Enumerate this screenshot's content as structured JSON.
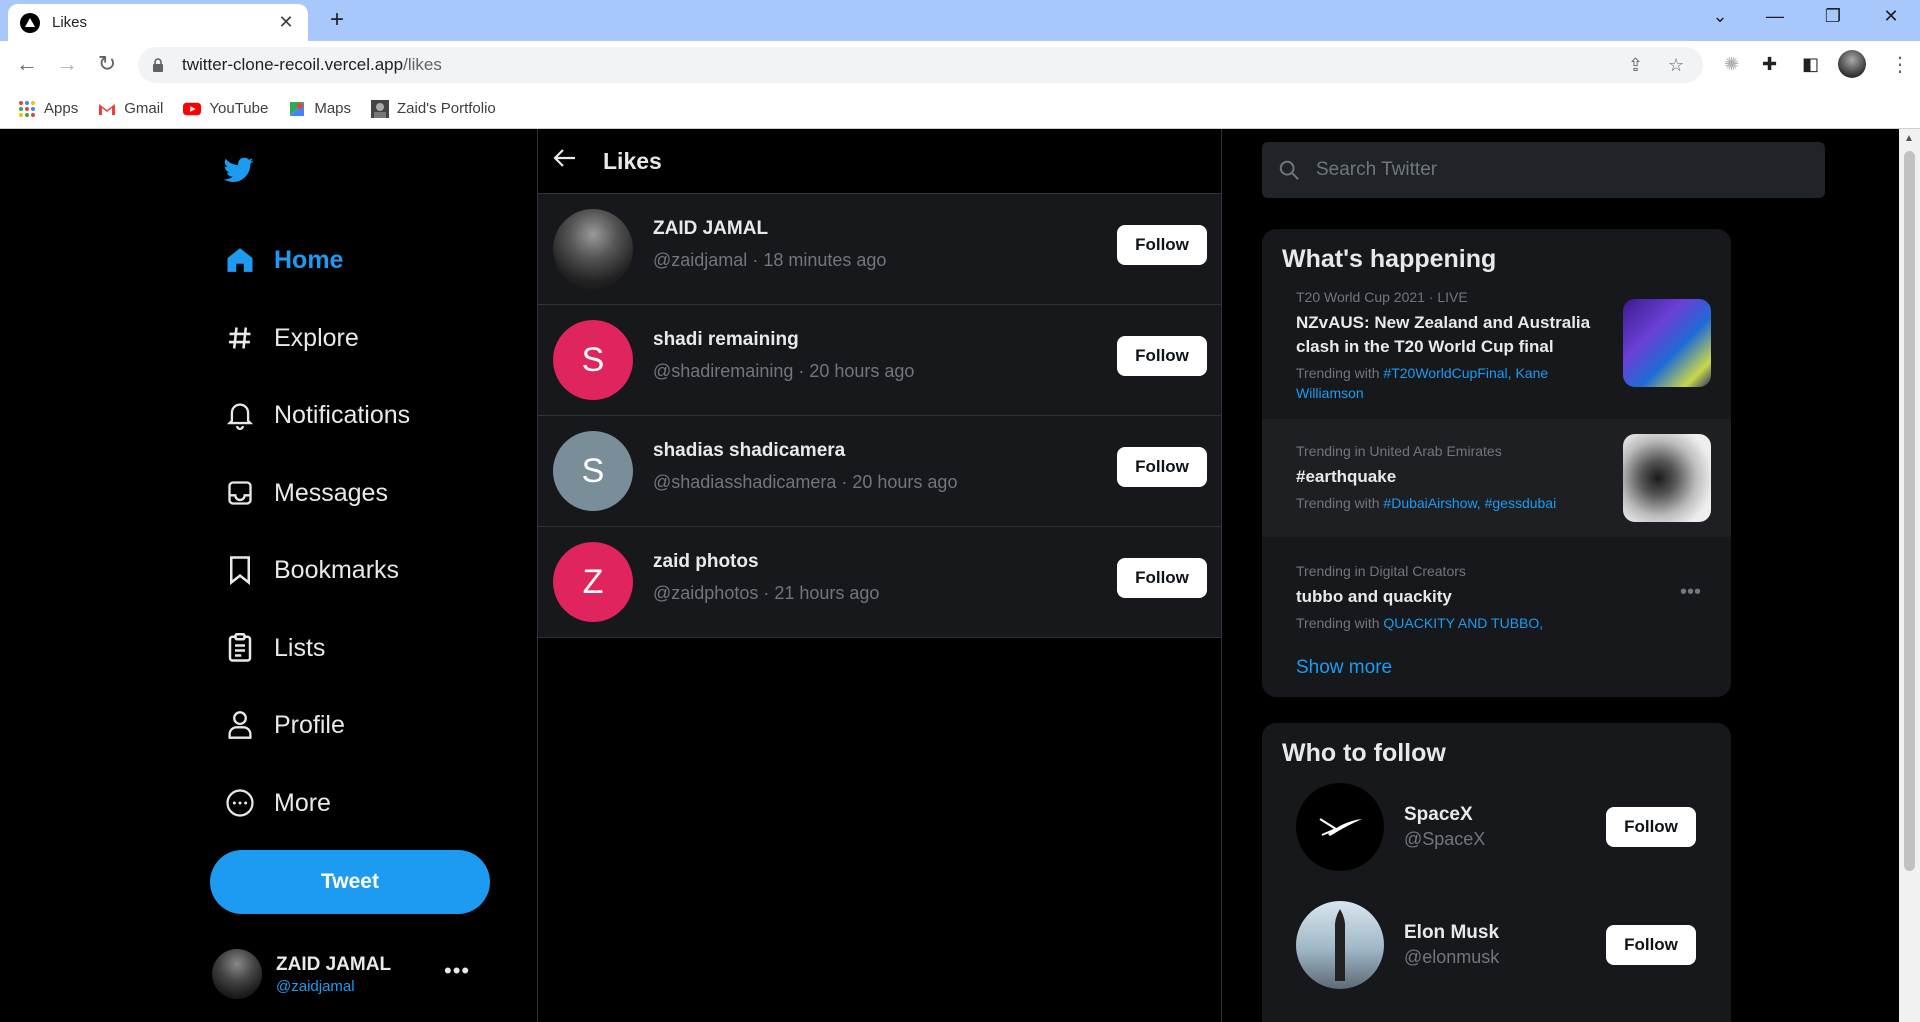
{
  "browser": {
    "tab_title": "Likes",
    "url_host": "twitter-clone-recoil.vercel.app",
    "url_path": "/likes",
    "bookmarks": [
      "Apps",
      "Gmail",
      "YouTube",
      "Maps",
      "Zaid's Portfolio"
    ]
  },
  "nav": {
    "items": [
      {
        "label": "Home",
        "icon": "home-icon",
        "active": true
      },
      {
        "label": "Explore",
        "icon": "hash-icon"
      },
      {
        "label": "Notifications",
        "icon": "bell-icon"
      },
      {
        "label": "Messages",
        "icon": "inbox-icon"
      },
      {
        "label": "Bookmarks",
        "icon": "bookmark-icon"
      },
      {
        "label": "Lists",
        "icon": "list-icon"
      },
      {
        "label": "Profile",
        "icon": "user-icon"
      },
      {
        "label": "More",
        "icon": "more-circle-icon"
      }
    ],
    "tweet_label": "Tweet",
    "user": {
      "name": "ZAID JAMAL",
      "handle": "@zaidjamal"
    }
  },
  "likes": {
    "title": "Likes",
    "users": [
      {
        "name": "ZAID JAMAL",
        "handle": "@zaidjamal",
        "time": "18 minutes ago",
        "initial": "",
        "color": "",
        "follow": "Follow"
      },
      {
        "name": "shadi remaining",
        "handle": "@shadiremaining",
        "time": "20 hours ago",
        "initial": "S",
        "color": "#e0245e",
        "follow": "Follow"
      },
      {
        "name": "shadias shadicamera",
        "handle": "@shadiasshadicamera",
        "time": "20 hours ago",
        "initial": "S",
        "color": "#7a8e9a",
        "follow": "Follow"
      },
      {
        "name": "zaid photos",
        "handle": "@zaidphotos",
        "time": "21 hours ago",
        "initial": "Z",
        "color": "#e0245e",
        "follow": "Follow"
      }
    ]
  },
  "search": {
    "placeholder": "Search Twitter"
  },
  "happening": {
    "title": "What's happening",
    "trends": [
      {
        "meta": "T20 World Cup 2021 · LIVE",
        "title": "NZvAUS: New Zealand and Australia clash in the T20 World Cup final",
        "with_prefix": "Trending with ",
        "tags": "#T20WorldCupFinal, Kane Williamson"
      },
      {
        "meta": "Trending in United Arab Emirates",
        "title": "#earthquake",
        "with_prefix": "Trending with ",
        "tags": "#DubaiAirshow, #gessdubai"
      },
      {
        "meta": "Trending in Digital Creators",
        "title": "tubbo and quackity",
        "with_prefix": "Trending with ",
        "tags": "QUACKITY AND TUBBO,"
      }
    ],
    "show_more": "Show more"
  },
  "who_to_follow": {
    "title": "Who to follow",
    "accounts": [
      {
        "name": "SpaceX",
        "handle": "@SpaceX",
        "follow": "Follow"
      },
      {
        "name": "Elon Musk",
        "handle": "@elonmusk",
        "follow": "Follow"
      }
    ]
  },
  "colors": {
    "accent": "#1d9bf0",
    "background": "#000000",
    "panel": "#16181c",
    "pink_avatar": "#e0245e",
    "gray_avatar": "#7a8e9a"
  }
}
